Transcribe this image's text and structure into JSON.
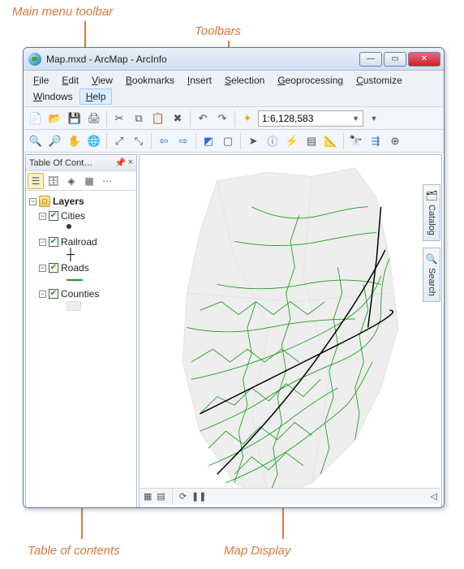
{
  "annotations": {
    "main_menu": "Main menu toolbar",
    "toolbars": "Toolbars",
    "toc": "Table of contents",
    "map": "Map Display"
  },
  "window": {
    "title": "Map.mxd - ArcMap - ArcInfo"
  },
  "menu": {
    "file": "File",
    "edit": "Edit",
    "view": "View",
    "bookmarks": "Bookmarks",
    "insert": "Insert",
    "selection": "Selection",
    "geoprocessing": "Geoprocessing",
    "customize": "Customize",
    "windows": "Windows",
    "help": "Help"
  },
  "standard_toolbar": {
    "scale": "1:6,128,583"
  },
  "toc": {
    "title": "Table Of Cont…",
    "root": "Layers",
    "layers": [
      {
        "name": "Cities",
        "checked": true,
        "symbol": "dot"
      },
      {
        "name": "Railroad",
        "checked": true,
        "symbol": "cross"
      },
      {
        "name": "Roads",
        "checked": true,
        "symbol": "greenline"
      },
      {
        "name": "Counties",
        "checked": true,
        "symbol": "greybox"
      }
    ]
  },
  "dock": {
    "catalog": "Catalog",
    "search": "Search"
  },
  "icons": {
    "minimize": "—",
    "maximize": "▭",
    "close": "✕",
    "pin": "📌",
    "x": "×",
    "dropdown": "▼",
    "refresh": "⟳",
    "pause": "❚❚"
  }
}
